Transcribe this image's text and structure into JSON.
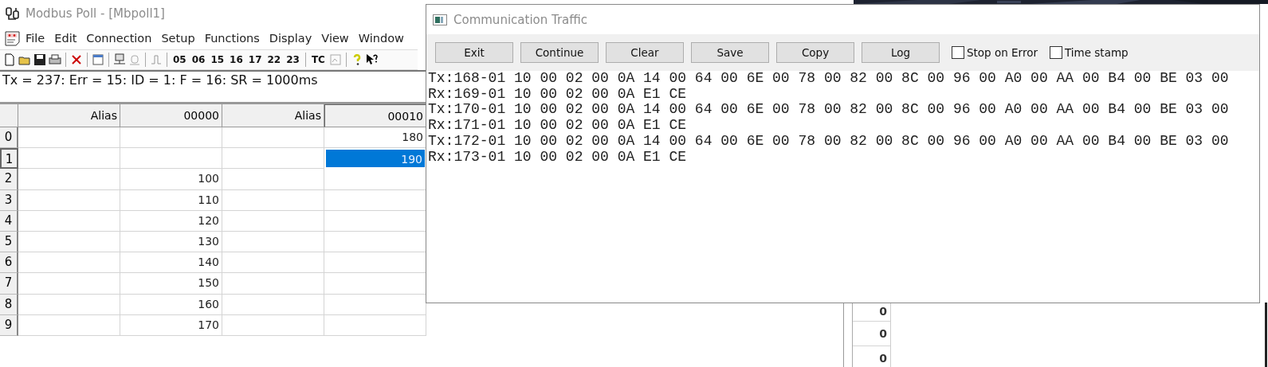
{
  "main_window": {
    "title": "Modbus Poll - [Mbpoll1]",
    "menu": [
      "File",
      "Edit",
      "Connection",
      "Setup",
      "Functions",
      "Display",
      "View",
      "Window"
    ],
    "toolbar": {
      "function_buttons": [
        "05",
        "06",
        "15",
        "16",
        "17",
        "22",
        "23"
      ],
      "tc_button": "TC"
    },
    "status": "Tx = 237: Err = 15: ID = 1: F = 16: SR = 1000ms",
    "table": {
      "columns": [
        "Alias",
        "00000",
        "Alias",
        "00010"
      ],
      "rows": [
        {
          "label": "0",
          "selected": false,
          "value_2": "180"
        },
        {
          "label": "1",
          "selected": true,
          "value_2": "190"
        },
        {
          "label": "2",
          "selected": false,
          "value_1": "100"
        },
        {
          "label": "3",
          "selected": false,
          "value_1": "110"
        },
        {
          "label": "4",
          "selected": false,
          "value_1": "120"
        },
        {
          "label": "5",
          "selected": false,
          "value_1": "130"
        },
        {
          "label": "6",
          "selected": false,
          "value_1": "140"
        },
        {
          "label": "7",
          "selected": false,
          "value_1": "150"
        },
        {
          "label": "8",
          "selected": false,
          "value_1": "160"
        },
        {
          "label": "9",
          "selected": false,
          "value_1": "170"
        }
      ]
    }
  },
  "traffic_window": {
    "title": "Communication Traffic",
    "buttons": [
      "Exit",
      "Continue",
      "Clear",
      "Save",
      "Copy",
      "Log"
    ],
    "checkboxes": [
      {
        "label": "Stop on Error",
        "checked": false
      },
      {
        "label": "Time stamp",
        "checked": false
      }
    ],
    "lines": [
      "Tx:168-01 10 00 02 00 0A 14 00 64 00 6E 00 78 00 82 00 8C 00 96 00 A0 00 AA 00 B4 00 BE 03 00",
      "Rx:169-01 10 00 02 00 0A E1 CE",
      "Tx:170-01 10 00 02 00 0A 14 00 64 00 6E 00 78 00 82 00 8C 00 96 00 A0 00 AA 00 B4 00 BE 03 00",
      "Rx:171-01 10 00 02 00 0A E1 CE",
      "Tx:172-01 10 00 02 00 0A 14 00 64 00 6E 00 78 00 82 00 8C 00 96 00 A0 00 AA 00 B4 00 BE 03 00",
      "Rx:173-01 10 00 02 00 0A E1 CE"
    ]
  },
  "background_window": {
    "cells": [
      "0",
      "0",
      "0"
    ]
  }
}
